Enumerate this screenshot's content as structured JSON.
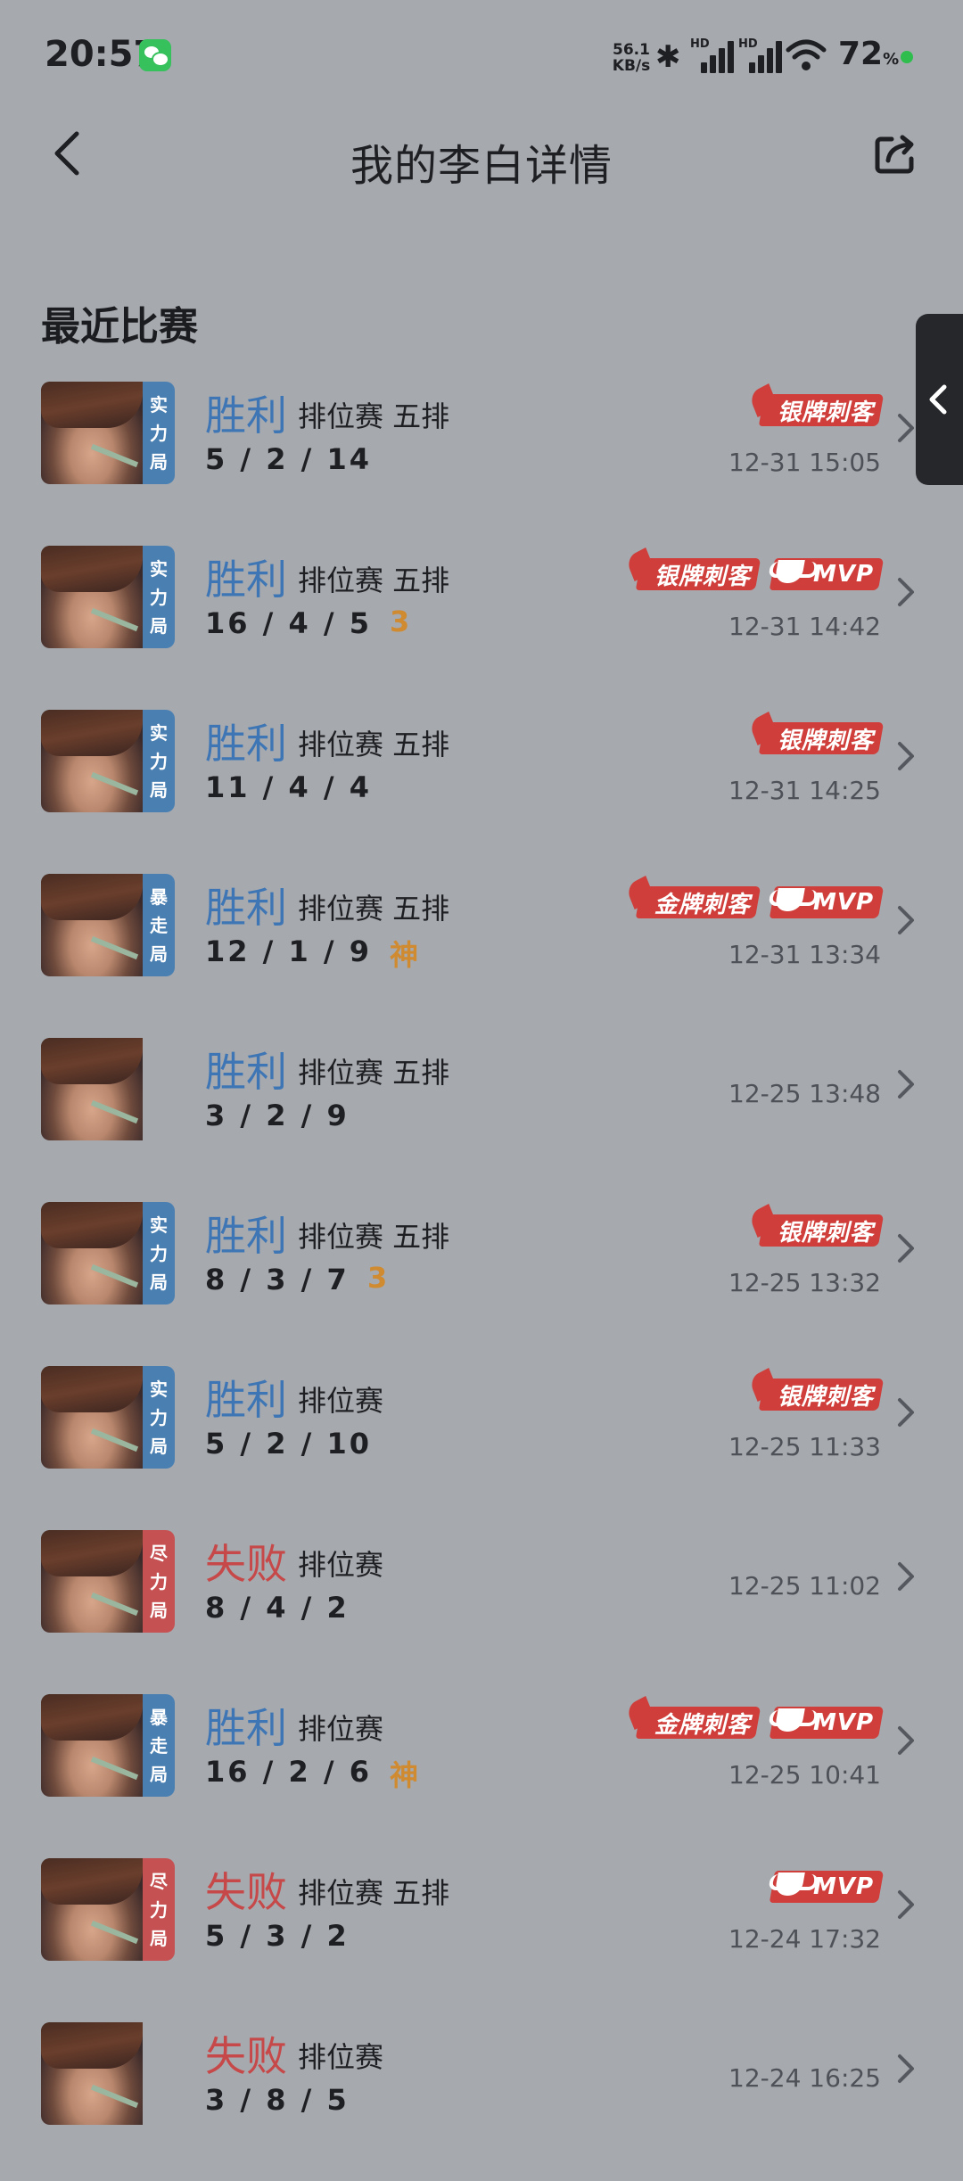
{
  "status_bar": {
    "time": "20:57",
    "net_speed_value": "56.1",
    "net_speed_unit": "KB/s",
    "signal_hd_1": "HD",
    "signal_hd_2": "HD",
    "battery": "72",
    "battery_unit": "%"
  },
  "header": {
    "title": "我的李白详情"
  },
  "section_title": "最近比赛",
  "matches": [
    {
      "result": "胜利",
      "result_type": "win",
      "mode_tag": [
        "实",
        "力",
        "局"
      ],
      "mode_color": "blue",
      "game_type": "排位赛 五排",
      "kda": "5 / 2 / 14",
      "kda_badge": "",
      "badges": [
        "银牌刺客"
      ],
      "mvp": false,
      "time": "12-31 15:05"
    },
    {
      "result": "胜利",
      "result_type": "win",
      "mode_tag": [
        "实",
        "力",
        "局"
      ],
      "mode_color": "blue",
      "game_type": "排位赛 五排",
      "kda": "16 / 4 / 5",
      "kda_badge": "3",
      "badges": [
        "银牌刺客"
      ],
      "mvp": true,
      "mvp_label": "MVP",
      "time": "12-31 14:42"
    },
    {
      "result": "胜利",
      "result_type": "win",
      "mode_tag": [
        "实",
        "力",
        "局"
      ],
      "mode_color": "blue",
      "game_type": "排位赛 五排",
      "kda": "11 / 4 / 4",
      "kda_badge": "",
      "badges": [
        "银牌刺客"
      ],
      "mvp": false,
      "time": "12-31 14:25"
    },
    {
      "result": "胜利",
      "result_type": "win",
      "mode_tag": [
        "暴",
        "走",
        "局"
      ],
      "mode_color": "blue",
      "game_type": "排位赛 五排",
      "kda": "12 / 1 / 9",
      "kda_badge": "神",
      "badges": [
        "金牌刺客"
      ],
      "mvp": true,
      "mvp_label": "MVP",
      "time": "12-31 13:34"
    },
    {
      "result": "胜利",
      "result_type": "win",
      "mode_tag": [],
      "mode_color": "none",
      "game_type": "排位赛 五排",
      "kda": "3 / 2 / 9",
      "kda_badge": "",
      "badges": [],
      "mvp": false,
      "time": "12-25 13:48"
    },
    {
      "result": "胜利",
      "result_type": "win",
      "mode_tag": [
        "实",
        "力",
        "局"
      ],
      "mode_color": "blue",
      "game_type": "排位赛 五排",
      "kda": "8 / 3 / 7",
      "kda_badge": "3",
      "badges": [
        "银牌刺客"
      ],
      "mvp": false,
      "time": "12-25 13:32"
    },
    {
      "result": "胜利",
      "result_type": "win",
      "mode_tag": [
        "实",
        "力",
        "局"
      ],
      "mode_color": "blue",
      "game_type": "排位赛",
      "kda": "5 / 2 / 10",
      "kda_badge": "",
      "badges": [
        "银牌刺客"
      ],
      "mvp": false,
      "time": "12-25 11:33"
    },
    {
      "result": "失败",
      "result_type": "lose",
      "mode_tag": [
        "尽",
        "力",
        "局"
      ],
      "mode_color": "red",
      "game_type": "排位赛",
      "kda": "8 / 4 / 2",
      "kda_badge": "",
      "badges": [],
      "mvp": false,
      "time": "12-25 11:02"
    },
    {
      "result": "胜利",
      "result_type": "win",
      "mode_tag": [
        "暴",
        "走",
        "局"
      ],
      "mode_color": "blue",
      "game_type": "排位赛",
      "kda": "16 / 2 / 6",
      "kda_badge": "神",
      "badges": [
        "金牌刺客"
      ],
      "mvp": true,
      "mvp_label": "MVP",
      "time": "12-25 10:41"
    },
    {
      "result": "失败",
      "result_type": "lose",
      "mode_tag": [
        "尽",
        "力",
        "局"
      ],
      "mode_color": "red",
      "game_type": "排位赛 五排",
      "kda": "5 / 3 / 2",
      "kda_badge": "",
      "badges": [],
      "mvp": true,
      "mvp_label": "MVP",
      "time": "12-24 17:32"
    },
    {
      "result": "失败",
      "result_type": "lose",
      "mode_tag": [],
      "mode_color": "none",
      "game_type": "排位赛",
      "kda": "3 / 8 / 5",
      "kda_badge": "",
      "badges": [],
      "mvp": false,
      "time": "12-24 16:25"
    }
  ],
  "icons": {
    "back": "back-arrow-icon",
    "share": "share-icon",
    "side_tab": "chevron-left-icon",
    "row_arrow": "chevron-right-icon"
  },
  "colors": {
    "win": "#3e76b5",
    "lose": "#c64848",
    "badge_red": "#cf3e3a",
    "kda_badge_gold": "#d08a30",
    "mode_blue": "#4a7fb2",
    "mode_red": "#c55153"
  }
}
